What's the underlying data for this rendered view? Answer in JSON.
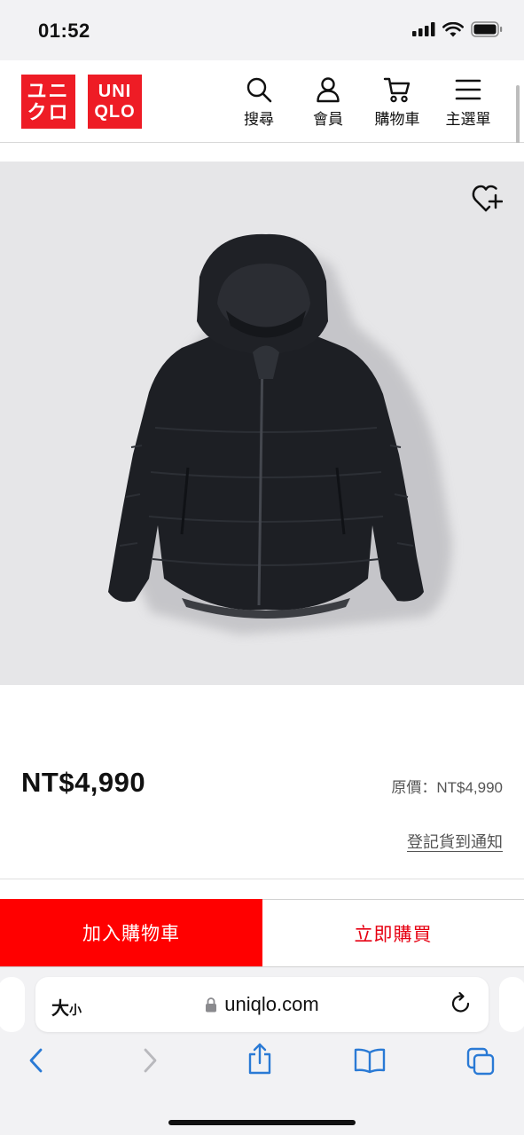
{
  "status_bar": {
    "time": "01:52"
  },
  "header": {
    "logo_katakana": [
      "ユニ",
      "クロ"
    ],
    "logo_latin": [
      "UNI",
      "QLO"
    ],
    "nav": {
      "search": "搜尋",
      "member": "會員",
      "cart": "購物車",
      "menu": "主選單"
    }
  },
  "product": {
    "price": "NT$4,990",
    "original_price": "原價：NT$4,990",
    "notify_link": "登記貨到通知",
    "favorite_icon": "heart-plus-icon"
  },
  "actions": {
    "add_to_cart": "加入購物車",
    "buy_now": "立即購買"
  },
  "browser": {
    "text_size": "大",
    "text_size_small": "小",
    "url": "uniqlo.com"
  },
  "colors": {
    "brand_red": "#ee1c25",
    "cart_button": "#ff0000",
    "buy_text": "#e60012"
  }
}
